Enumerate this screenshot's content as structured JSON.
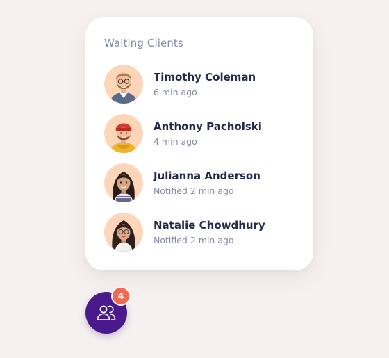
{
  "panel": {
    "title": "Waiting Clients"
  },
  "clients": [
    {
      "name": "Timothy Coleman",
      "status": "6 min ago",
      "avatar_icon": "man-with-glasses-avatar"
    },
    {
      "name": "Anthony Pacholski",
      "status": "4 min ago",
      "avatar_icon": "man-with-red-beanie-avatar"
    },
    {
      "name": "Julianna Anderson",
      "status": "Notified 2 min ago",
      "avatar_icon": "woman-with-dark-hair-avatar"
    },
    {
      "name": "Natalie Chowdhury",
      "status": "Notified 2 min ago",
      "avatar_icon": "woman-with-glasses-avatar"
    }
  ],
  "launcher": {
    "icon": "users-icon",
    "badge_count": "4"
  },
  "colors": {
    "background": "#f6f1f0",
    "card": "#ffffff",
    "title": "#7f8aa8",
    "name": "#232a4a",
    "status": "#838aa3",
    "launcher": "#4a1a8c",
    "badge": "#ef6a52",
    "avatar_background": "#fdd5b9"
  }
}
